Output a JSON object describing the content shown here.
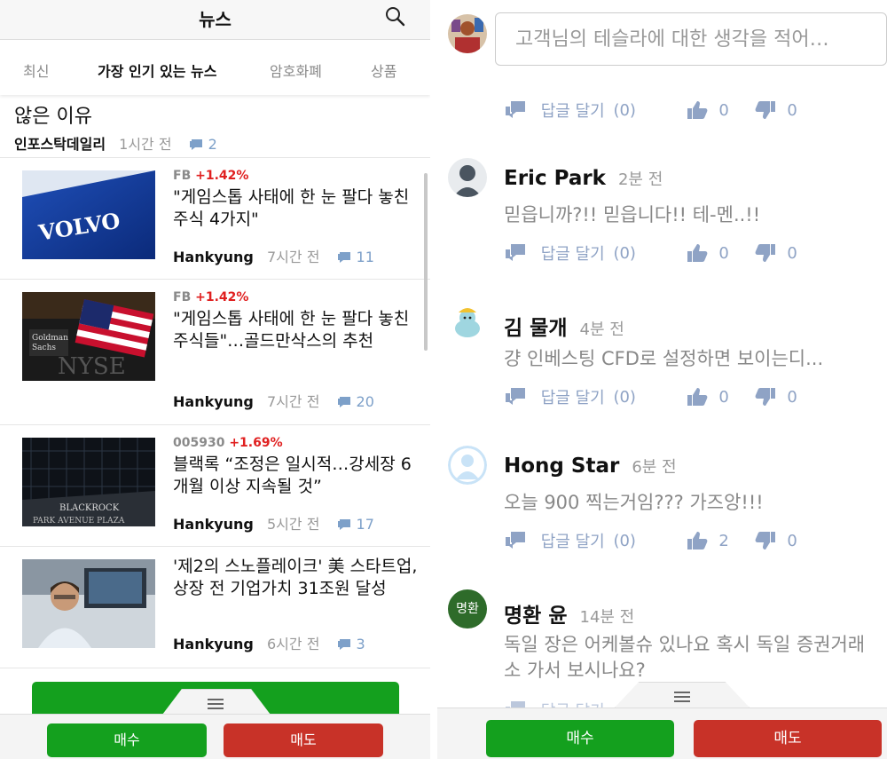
{
  "left": {
    "header_title": "뉴스",
    "tabs": [
      "최신",
      "가장 인기 있는 뉴스",
      "암호화폐",
      "상품"
    ],
    "top_article": {
      "title_tail": "않은 이유",
      "source": "인포스탁데일리",
      "time": "1시간 전",
      "comments": "2"
    },
    "news": [
      {
        "ticker": "FB",
        "change": "+1.42%",
        "headline": "\"게임스톱 사태에 한 눈 팔다 놓친 주식 4가지\"",
        "source": "Hankyung",
        "time": "7시간 전",
        "comments": "11",
        "thumb": "volvo"
      },
      {
        "ticker": "FB",
        "change": "+1.42%",
        "headline": "\"게임스톱 사태에 한 눈 팔다 놓친 주식들\"…골드만삭스의 추천",
        "source": "Hankyung",
        "time": "7시간 전",
        "comments": "20",
        "thumb": "nyse"
      },
      {
        "ticker": "005930",
        "change": "+1.69%",
        "headline": "블랙록 “조정은 일시적…강세장 6개월 이상 지속될 것”",
        "source": "Hankyung",
        "time": "5시간 전",
        "comments": "17",
        "thumb": "blackrock"
      },
      {
        "ticker": "",
        "change": "",
        "headline": "'제2의 스노플레이크' 美 스타트업, 상장 전 기업가치 31조원 달성",
        "source": "Hankyung",
        "time": "6시간 전",
        "comments": "3",
        "thumb": "trader"
      }
    ],
    "buy": "매수",
    "sell": "매도"
  },
  "right": {
    "comment_placeholder": "고객님의 테슬라에 대한 생각을 적어…",
    "reply_label": "답글 달기",
    "first_actions": {
      "replies": "(0)",
      "likes": "0",
      "dislikes": "0"
    },
    "comments": [
      {
        "name": "Eric Park",
        "time": "2분 전",
        "text": "믿읍니까?!! 믿읍니다!! 테-멘..!!",
        "replies": "(0)",
        "likes": "0",
        "dislikes": "0",
        "avatar": "silhouette"
      },
      {
        "name": "김 물개",
        "time": "4분 전",
        "text": "걍 인베스팅 CFD로 설정하면 보이는디...",
        "replies": "(0)",
        "likes": "0",
        "dislikes": "0",
        "avatar": "seal"
      },
      {
        "name": "Hong Star",
        "time": "6분 전",
        "text": "오늘 900 찍는거임??? 가즈앙!!!",
        "replies": "(0)",
        "likes": "2",
        "dislikes": "0",
        "avatar": "default"
      },
      {
        "name": "명환 윤",
        "time": "14분 전",
        "text": "독일 장은 어케볼슈 있나요 혹시 독일 증권거래소 가서 보시나요?",
        "avatar_text": "명환",
        "avatar": "initials"
      }
    ],
    "buy": "매수",
    "sell": "매도"
  },
  "colors": {
    "buy": "#14a01e",
    "sell": "#c83228",
    "gain": "#e02020",
    "link": "#8fa3c5"
  }
}
